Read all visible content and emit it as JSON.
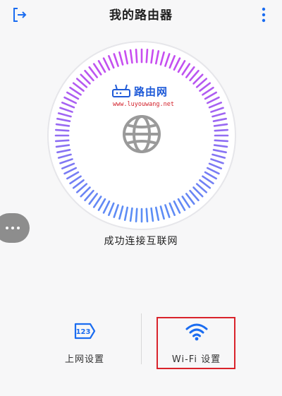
{
  "header": {
    "title": "我的路由器",
    "exit_icon": "exit-icon",
    "more_icon": "more-vertical-icon"
  },
  "watermark": {
    "name": "路由网",
    "url": "www.luyouwang.net"
  },
  "status": {
    "text": "成功连接互联网",
    "icon": "globe-icon"
  },
  "floating_button": {
    "icon": "more-horizontal-icon"
  },
  "bottom_actions": [
    {
      "label": "上网设置",
      "icon": "numeric-123-icon",
      "icon_text": "123"
    },
    {
      "label": "Wi-Fi 设置",
      "icon": "wifi-icon"
    }
  ],
  "colors": {
    "accent_blue": "#1a6cf0",
    "dial_gradient_start": "#c84df0",
    "dial_gradient_end": "#5b8df5",
    "highlight_red": "#d9232b"
  }
}
